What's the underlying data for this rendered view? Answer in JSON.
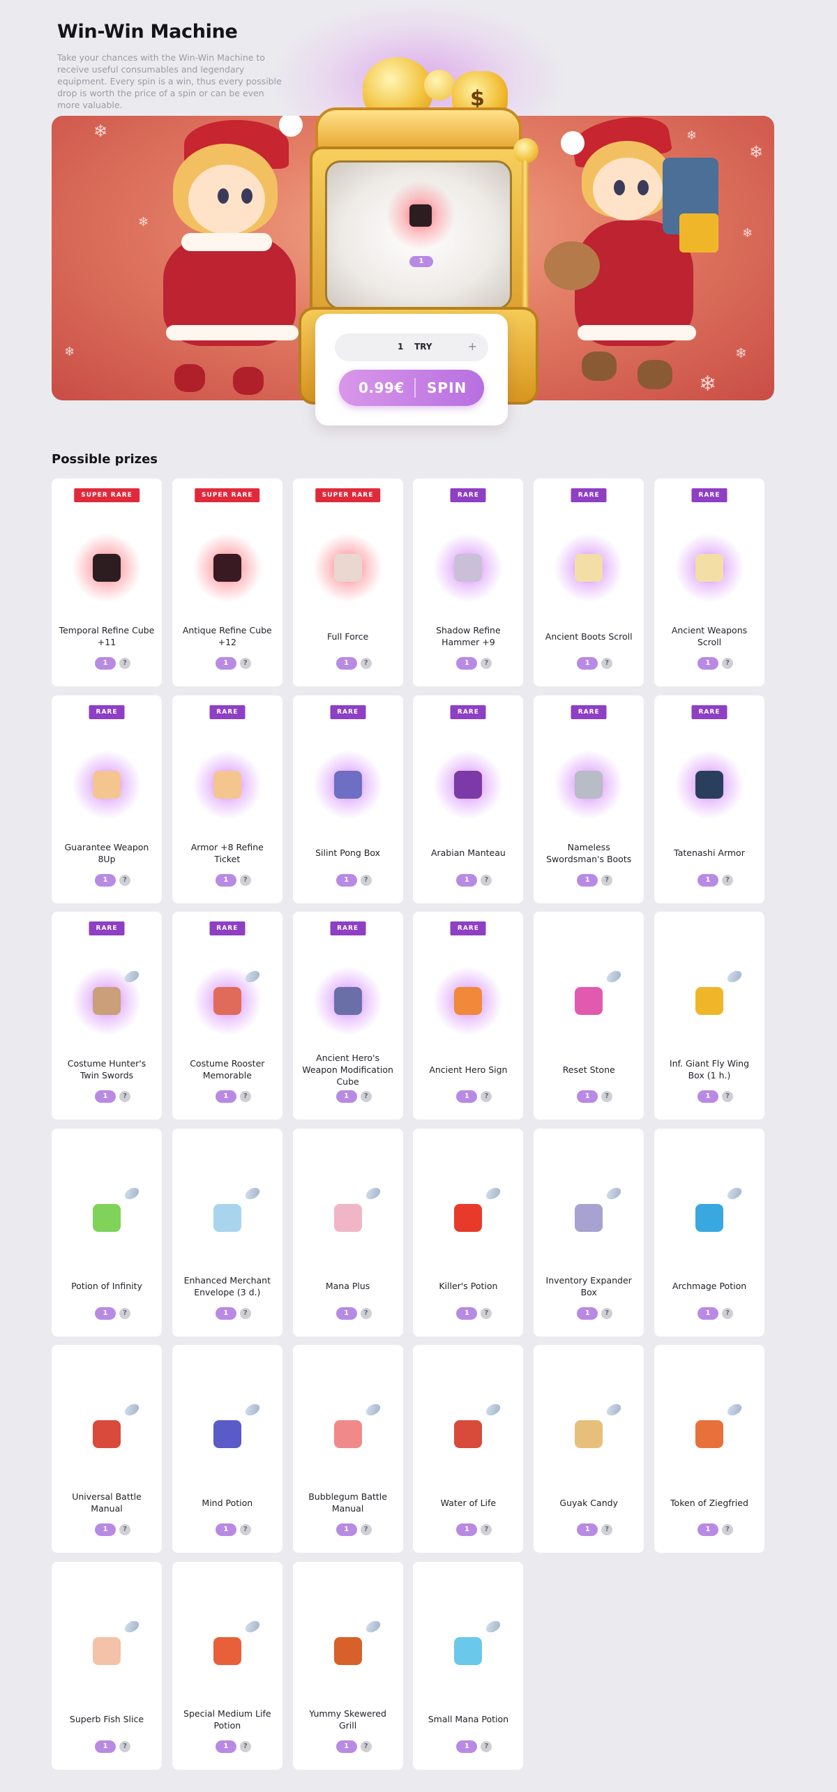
{
  "header": {
    "title": "Win-Win Machine",
    "description": "Take your chances with the Win-Win Machine to receive useful consumables and legendary equipment. Every spin is a win, thus every possible drop is worth the price of a spin or can be even more valuable."
  },
  "machine": {
    "current_prize_qty": "1",
    "try_count": "1",
    "try_label": "TRY",
    "plus_symbol": "+",
    "spin_price": "0.99€",
    "spin_label": "SPIN"
  },
  "prizes": {
    "title": "Possible prizes",
    "qmark": "?",
    "items": [
      {
        "tag": "SUPER RARE",
        "rarity": "super",
        "name": "Temporal Refine Cube +11",
        "qty": "1",
        "color": "#2b1d20",
        "icon": "cube-icon"
      },
      {
        "tag": "SUPER RARE",
        "rarity": "super",
        "name": "Antique Refine Cube +12",
        "qty": "1",
        "color": "#3a1a22",
        "icon": "cube-icon"
      },
      {
        "tag": "SUPER RARE",
        "rarity": "super",
        "name": "Full Force",
        "qty": "1",
        "color": "#e9d7d0",
        "icon": "sword-icon"
      },
      {
        "tag": "RARE",
        "rarity": "rare",
        "name": "Shadow Refine Hammer +9",
        "qty": "1",
        "color": "#c9c0d8",
        "icon": "hammer-icon"
      },
      {
        "tag": "RARE",
        "rarity": "rare",
        "name": "Ancient Boots Scroll",
        "qty": "1",
        "color": "#f3dfa6",
        "icon": "scroll-icon"
      },
      {
        "tag": "RARE",
        "rarity": "rare",
        "name": "Ancient Weapons Scroll",
        "qty": "1",
        "color": "#f3dfa6",
        "icon": "scroll-icon"
      },
      {
        "tag": "RARE",
        "rarity": "rare",
        "name": "Guarantee Weapon 8Up",
        "qty": "1",
        "color": "#f5c58f",
        "icon": "ticket-icon"
      },
      {
        "tag": "RARE",
        "rarity": "rare",
        "name": "Armor +8 Refine Ticket",
        "qty": "1",
        "color": "#f5c58f",
        "icon": "ticket-icon"
      },
      {
        "tag": "RARE",
        "rarity": "rare",
        "name": "Silint Pong Box",
        "qty": "1",
        "color": "#6d6ec4",
        "icon": "box-icon"
      },
      {
        "tag": "RARE",
        "rarity": "rare",
        "name": "Arabian Manteau",
        "qty": "1",
        "color": "#7b3aa8",
        "icon": "cape-icon"
      },
      {
        "tag": "RARE",
        "rarity": "rare",
        "name": "Nameless Swordsman's Boots",
        "qty": "1",
        "color": "#b7bcc6",
        "icon": "boots-icon"
      },
      {
        "tag": "RARE",
        "rarity": "rare",
        "name": "Tatenashi Armor",
        "qty": "1",
        "color": "#2a3f5c",
        "icon": "armor-icon"
      },
      {
        "tag": "RARE",
        "rarity": "rare",
        "name": "Costume Hunter's Twin Swords",
        "qty": "1",
        "color": "#c9a07a",
        "icon": "swords-icon",
        "bonus": true
      },
      {
        "tag": "RARE",
        "rarity": "rare",
        "name": "Costume Rooster Memorable",
        "qty": "1",
        "color": "#e06b5a",
        "icon": "rooster-icon",
        "bonus": true
      },
      {
        "tag": "RARE",
        "rarity": "rare",
        "name": "Ancient Hero's Weapon Modification Cube",
        "qty": "1",
        "color": "#6b6fa8",
        "icon": "cube-icon"
      },
      {
        "tag": "RARE",
        "rarity": "rare",
        "name": "Ancient Hero Sign",
        "qty": "1",
        "color": "#f08a3a",
        "icon": "sign-icon"
      },
      {
        "tag": "",
        "rarity": "none",
        "name": "Reset Stone",
        "qty": "1",
        "color": "#e25ab0",
        "icon": "stone-icon",
        "bonus": true
      },
      {
        "tag": "",
        "rarity": "none",
        "name": "Inf. Giant Fly Wing Box (1 h.)",
        "qty": "1",
        "color": "#f0b62a",
        "icon": "gift-icon",
        "bonus": true
      },
      {
        "tag": "",
        "rarity": "none",
        "name": "Potion of Infinity",
        "qty": "1",
        "color": "#7fd35a",
        "icon": "potion-icon",
        "bonus": true
      },
      {
        "tag": "",
        "rarity": "none",
        "name": "Enhanced Merchant Envelope (3 d.)",
        "qty": "1",
        "color": "#a9d4ee",
        "icon": "envelope-icon",
        "bonus": true
      },
      {
        "tag": "",
        "rarity": "none",
        "name": "Mana Plus",
        "qty": "1",
        "color": "#f0b6c8",
        "icon": "potion-icon",
        "bonus": true
      },
      {
        "tag": "",
        "rarity": "none",
        "name": "Killer's Potion",
        "qty": "1",
        "color": "#e83a2a",
        "icon": "potion-icon",
        "bonus": true
      },
      {
        "tag": "",
        "rarity": "none",
        "name": "Inventory Expander Box",
        "qty": "1",
        "color": "#a7a2cf",
        "icon": "box-icon",
        "bonus": true
      },
      {
        "tag": "",
        "rarity": "none",
        "name": "Archmage Potion",
        "qty": "1",
        "color": "#3aa8e0",
        "icon": "potion-icon",
        "bonus": true
      },
      {
        "tag": "",
        "rarity": "none",
        "name": "Universal Battle Manual",
        "qty": "1",
        "color": "#d94a3a",
        "icon": "book-icon",
        "bonus": true
      },
      {
        "tag": "",
        "rarity": "none",
        "name": "Mind Potion",
        "qty": "1",
        "color": "#5a5ac8",
        "icon": "potion-icon",
        "bonus": true
      },
      {
        "tag": "",
        "rarity": "none",
        "name": "Bubblegum Battle Manual",
        "qty": "1",
        "color": "#f08a8a",
        "icon": "book-icon",
        "bonus": true
      },
      {
        "tag": "",
        "rarity": "none",
        "name": "Water of Life",
        "qty": "1",
        "color": "#d84a3a",
        "icon": "potion-icon",
        "bonus": true
      },
      {
        "tag": "",
        "rarity": "none",
        "name": "Guyak Candy",
        "qty": "1",
        "color": "#e6c07a",
        "icon": "candy-icon",
        "bonus": true
      },
      {
        "tag": "",
        "rarity": "none",
        "name": "Token of Ziegfried",
        "qty": "1",
        "color": "#e8703a",
        "icon": "token-icon",
        "bonus": true
      },
      {
        "tag": "",
        "rarity": "none",
        "name": "Superb Fish Slice",
        "qty": "1",
        "color": "#f3c2a8",
        "icon": "fish-icon",
        "bonus": true
      },
      {
        "tag": "",
        "rarity": "none",
        "name": "Special Medium Life Potion",
        "qty": "1",
        "color": "#e8603a",
        "icon": "jar-icon",
        "bonus": true
      },
      {
        "tag": "",
        "rarity": "none",
        "name": "Yummy Skewered Grill",
        "qty": "1",
        "color": "#d8602a",
        "icon": "skewer-icon",
        "bonus": true
      },
      {
        "tag": "",
        "rarity": "none",
        "name": "Small Mana Potion",
        "qty": "1",
        "color": "#6ac8ea",
        "icon": "jar-icon",
        "bonus": true
      }
    ]
  }
}
